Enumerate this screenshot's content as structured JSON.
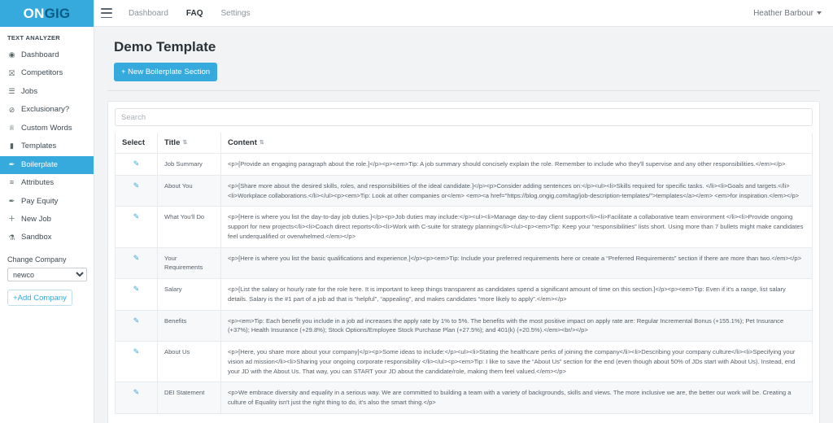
{
  "brand": {
    "part1": "ON",
    "part2": "GIG"
  },
  "sidebar": {
    "section_title": "TEXT ANALYZER",
    "items": [
      {
        "label": "Dashboard",
        "icon": "dashboard-icon",
        "glyph": "◉",
        "active": false
      },
      {
        "label": "Competitors",
        "icon": "competitors-icon",
        "glyph": "⛝",
        "active": false
      },
      {
        "label": "Jobs",
        "icon": "list-icon",
        "glyph": "☰",
        "active": false
      },
      {
        "label": "Exclusionary?",
        "icon": "ban-icon",
        "glyph": "⊘",
        "active": false
      },
      {
        "label": "Custom Words",
        "icon": "trophy-icon",
        "glyph": "♕",
        "active": false
      },
      {
        "label": "Templates",
        "icon": "file-icon",
        "glyph": "▮",
        "active": false
      },
      {
        "label": "Boilerplate",
        "icon": "pin-icon",
        "glyph": "✒",
        "active": true
      },
      {
        "label": "Attributes",
        "icon": "layers-icon",
        "glyph": "≡",
        "active": false
      },
      {
        "label": "Pay Equity",
        "icon": "pin-icon",
        "glyph": "✒",
        "active": false
      },
      {
        "label": "New Job",
        "icon": "plus-icon",
        "glyph": "＋",
        "active": false
      },
      {
        "label": "Sandbox",
        "icon": "flask-icon",
        "glyph": "⚗",
        "active": false
      }
    ],
    "change_company_label": "Change Company",
    "company_selected": "newco",
    "company_options": [
      "newco"
    ],
    "add_company_label": "+Add Company"
  },
  "topbar": {
    "menu_icon": "hamburger-icon",
    "nav": [
      {
        "label": "Dashboard",
        "active": false
      },
      {
        "label": "FAQ",
        "active": true
      },
      {
        "label": "Settings",
        "active": false
      }
    ],
    "user": "Heather Barbour"
  },
  "page": {
    "title": "Demo Template",
    "new_section_button": "+ New Boilerplate Section"
  },
  "table": {
    "search_placeholder": "Search",
    "search_value": "",
    "columns": [
      {
        "label": "Select",
        "sortable": false
      },
      {
        "label": "Title",
        "sortable": true
      },
      {
        "label": "Content",
        "sortable": true
      }
    ],
    "sort_glyph": "⇅",
    "edit_glyph": "✎",
    "rows": [
      {
        "title": "Job Summary",
        "content": "<p>[Provide an engaging paragraph about the role.]</p><p><em>Tip: A job summary should concisely explain the role. Remember to include who they'll supervise and any other responsibilities.</em></p>"
      },
      {
        "title": "About You",
        "content": "<p>[Share more about the desired skills, roles, and responsibilities of the ideal candidate.]</p><p>Consider adding sentences on:</p><ul><li>Skills required for specific tasks. </li><li>Goals and targets.</li><li>Workplace collaborations.</li></ul><p><em>Tip: Look at other companies or</em> <em><a href=\"https://blog.ongig.com/tag/job-description-templates/\">templates</a></em> <em>for inspiration.</em></p>"
      },
      {
        "title": "What You'll Do",
        "content": "<p>[Here is where you list the day-to-day job duties.]</p><p>Job duties may include:</p><ul><li>Manage day-to-day client support</li><li>Facilitate a collaborative team environment </li><li>Provide ongoing support for new projects</li><li>Coach direct reports</li><li>Work with C-suite for strategy planning</li></ul><p><em>Tip: Keep your “responsibilities” lists short. Using more than 7 bullets might make candidates feel underqualified or overwhelmed.</em></p>"
      },
      {
        "title": "Your Requirements",
        "content": "<p>[Here is where you list the basic qualifications and experience.]</p><p><em>Tip: Include your preferred requirements here or create a “Preferred Requirements” section if there are more than two.</em></p>"
      },
      {
        "title": "Salary",
        "content": "<p>[List the salary or hourly rate for the role here. It is important to keep things transparent as candidates spend a significant amount of time on this section.]</p><p><em>Tip: Even if it's a range, list salary details. Salary is the #1 part of a job ad that is “helpful”, “appealing”, and makes candidates “more likely to apply”.</em></p>"
      },
      {
        "title": "Benefits",
        "content": "<p><em>Tip: Each benefit you include in a job ad increases the apply rate by 1% to 5%. The benefits with the most positive impact on apply rate are: Regular Incremental Bonus (+155.1%); Pet Insurance (+37%); Health Insurance (+29.8%); Stock Options/Employee Stock Purchase Plan (+27.5%); and 401(k) (+20.5%).</em><br/></p>"
      },
      {
        "title": "About Us",
        "content": "<p>[Here, you share more about your company]</p><p>Some ideas to include:</p><ul><li>Stating the healthcare perks of joining the company</li><li>Describing your company culture</li><li>Specifying your vision ad mission</li><li>Sharing your ongoing corporate responsibility </li></ul><p><em>Tip: I like to save the “About Us” section for the end (even though about 50% of JDs start with About Us). Instead, end your JD with the About Us. That way, you can START your JD about the candidate/role, making them feel valued.</em></p>"
      },
      {
        "title": "DEI Statement",
        "content": "<p>We embrace diversity and equality in a serious way. We are committed to building a team with a variety of backgrounds, skills and views. The more inclusive we are, the better our work will be. Creating a culture of Equality isn't just the right thing to do, it's also the smart thing.</p>"
      }
    ]
  },
  "colors": {
    "brand_blue": "#36a9dd",
    "brand_dark": "#0b5d87",
    "page_bg": "#f1f3f5",
    "row_alt": "#f7f8f9"
  }
}
